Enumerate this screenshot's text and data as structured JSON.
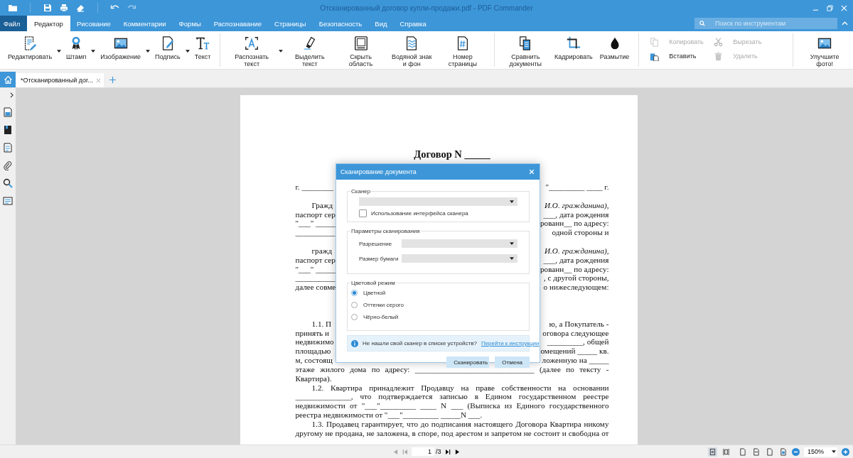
{
  "window": {
    "title": "Отсканированный договор купли-продажи.pdf - PDF Commander"
  },
  "menu": {
    "file": "Файл",
    "tabs": [
      {
        "label": "Редактор",
        "selected": true
      },
      {
        "label": "Рисование",
        "selected": false
      },
      {
        "label": "Комментарии",
        "selected": false
      },
      {
        "label": "Формы",
        "selected": false
      },
      {
        "label": "Распознавание",
        "selected": false
      },
      {
        "label": "Страницы",
        "selected": false
      },
      {
        "label": "Безопасность",
        "selected": false
      },
      {
        "label": "Вид",
        "selected": false
      },
      {
        "label": "Справка",
        "selected": false
      }
    ]
  },
  "search": {
    "placeholder": "Поиск по инструментам"
  },
  "ribbon": {
    "groups": [
      {
        "kind": "large",
        "items": [
          {
            "label": "Редактировать",
            "dropdown": true
          },
          {
            "label": "Штамп",
            "dropdown": true
          },
          {
            "label": "Изображение",
            "dropdown": true
          },
          {
            "label": "Подпись",
            "dropdown": true
          },
          {
            "label": "Текст",
            "dropdown": false
          }
        ]
      },
      {
        "kind": "large",
        "items": [
          {
            "label": "Распознать текст",
            "dropdown": true
          },
          {
            "label": "Выделить текст",
            "dropdown": false
          },
          {
            "label": "Скрыть область",
            "dropdown": false
          },
          {
            "label": "Водяной знак и фон",
            "dropdown": false
          },
          {
            "label": "Номер страницы",
            "dropdown": false
          }
        ]
      },
      {
        "kind": "large",
        "items": [
          {
            "label": "Сравнить документы",
            "dropdown": false
          },
          {
            "label": "Кадрировать",
            "dropdown": false
          },
          {
            "label": "Размытие",
            "dropdown": false
          }
        ]
      },
      {
        "kind": "small",
        "items": [
          {
            "label": "Копировать",
            "disabled": true
          },
          {
            "label": "Вырезать",
            "disabled": true
          },
          {
            "label": "Вставить",
            "disabled": false
          },
          {
            "label": "Удалить",
            "disabled": true
          }
        ]
      },
      {
        "kind": "large",
        "items": [
          {
            "label": "Улучшите фото!",
            "dropdown": false
          }
        ]
      }
    ]
  },
  "doc_tabs": [
    {
      "label": "*Отсканированный дог...",
      "selected": true
    }
  ],
  "document": {
    "title": "Договор N _____",
    "lines": [
      {
        "kind": "split",
        "indent": false,
        "left": "г. ________",
        "right": "\"_________ ____ г."
      },
      {
        "kind": "blank"
      },
      {
        "kind": "split",
        "indent": true,
        "left": "Гражд",
        "right": "И.О.   гражданина),",
        "italic_right": true
      },
      {
        "kind": "split",
        "indent": false,
        "left": "паспорт сер",
        "right": "___, дата рождения"
      },
      {
        "kind": "split",
        "indent": false,
        "left": "\"___\" _____",
        "right": "рованн__ по адресу:"
      },
      {
        "kind": "split",
        "indent": false,
        "left": "__________",
        "right": "одной стороны и"
      },
      {
        "kind": "blank"
      },
      {
        "kind": "split",
        "indent": true,
        "left": "гражд",
        "right": "И.О.   гражданина),",
        "italic_right": true
      },
      {
        "kind": "split",
        "indent": false,
        "left": "паспорт сер",
        "right": "___, дата рождения"
      },
      {
        "kind": "split",
        "indent": false,
        "left": "\"___\" _____",
        "right": "рованн__ по адресу:"
      },
      {
        "kind": "split",
        "indent": false,
        "left": "__________",
        "right": ", с другой стороны,"
      },
      {
        "kind": "split",
        "indent": false,
        "left": "далее совме",
        "right": "о нижеследующем:"
      },
      {
        "kind": "blank"
      },
      {
        "kind": "blank"
      },
      {
        "kind": "blank"
      },
      {
        "kind": "split",
        "indent": true,
        "left": "1.1. П",
        "right": "ю, а Покупатель -"
      },
      {
        "kind": "split",
        "indent": false,
        "left": "принять и",
        "right": "оговора следующее"
      },
      {
        "kind": "split",
        "indent": false,
        "left": "недвижимо",
        "right": "_________, общей"
      },
      {
        "kind": "split",
        "indent": false,
        "left": "площадью",
        "right": "омещений _____ кв."
      },
      {
        "kind": "split",
        "indent": false,
        "left": "м, состоящ",
        "right": "ложенную на _____"
      },
      {
        "kind": "full",
        "indent": false,
        "text": "этаже жилого дома по адресу: ______________________________ (далее по тексту -"
      },
      {
        "kind": "last",
        "indent": false,
        "text": "Квартира)."
      },
      {
        "kind": "full",
        "indent": true,
        "text": "1.2.   Квартира принадлежит Продавцу на праве собственности на основании"
      },
      {
        "kind": "full",
        "indent": false,
        "text": "______________, что подтверждается записью в Едином государственном реестре"
      },
      {
        "kind": "full",
        "indent": false,
        "text": "недвижимости от \"___\"_________ ____ N ___ (Выписка из Единого государственного"
      },
      {
        "kind": "last",
        "indent": false,
        "text": "реестра недвижимости от \"___\"_________ _____N ___."
      },
      {
        "kind": "full",
        "indent": true,
        "text": "1.3. Продавец гарантирует, что до подписания настоящего Договора Квартира никому"
      },
      {
        "kind": "full",
        "indent": false,
        "text": "другому не продана, не заложена, в споре, под арестом и запретом не состоит и свободна от"
      }
    ]
  },
  "dialog": {
    "title": "Сканирование документа",
    "scanner": {
      "legend": "Сканер",
      "use_interface": {
        "label": "Использование интерфейса сканера",
        "checked": false
      }
    },
    "params": {
      "legend": "Параметры сканирования",
      "fields": [
        {
          "label": "Разрешение"
        },
        {
          "label": "Размер бумаги"
        }
      ]
    },
    "color_mode": {
      "legend": "Цветовой режим",
      "options": [
        {
          "label": "Цветной",
          "selected": true
        },
        {
          "label": "Оттенки серого",
          "selected": false
        },
        {
          "label": "Чёрно-белый",
          "selected": false
        }
      ]
    },
    "hint": {
      "text": "Не нашли свой сканер в списке устройств?",
      "link": "Перейти к инструкции"
    },
    "buttons": [
      {
        "label": "Сканировать"
      },
      {
        "label": "Отмена"
      }
    ]
  },
  "status": {
    "page": "1",
    "total": "/3",
    "zoom": "150%"
  }
}
